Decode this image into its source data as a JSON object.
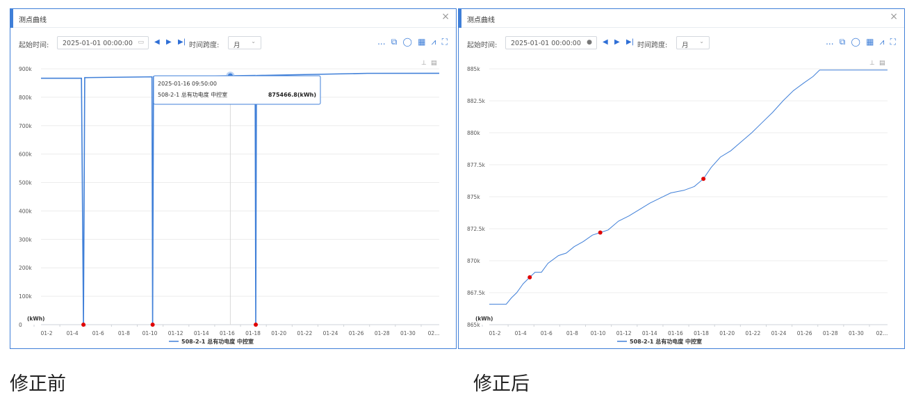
{
  "panels": [
    {
      "title": "测点曲线",
      "close": "×",
      "start_label": "起始时间:",
      "start_value": "2025-01-01 00:00:00",
      "span_label": "时间跨度:",
      "span_value": "月",
      "more": "...",
      "unit": "(kWh)",
      "legend": "508-2-1 总有功电度 中控室",
      "tooltip": {
        "time": "2025-01-16 09:50:00",
        "series": "508-2-1 总有功电度 中控室",
        "value": "875466.8(kWh)"
      }
    },
    {
      "title": "测点曲线",
      "close": "×",
      "start_label": "起始时间:",
      "start_value": "2025-01-01 00:00:00",
      "span_label": "时间跨度:",
      "span_value": "月",
      "more": "...",
      "unit": "(kWh)",
      "legend": "508-2-1 总有功电度 中控室"
    }
  ],
  "captions": {
    "before": "修正前",
    "after": "修正后"
  },
  "colors": {
    "line": "#3f7fd8",
    "marker": "#e00000",
    "frame": "#3f7fd8",
    "grid": "#ececec"
  },
  "icons": [
    "calendar-icon",
    "prev-icon",
    "next-icon",
    "last-icon",
    "export-icon",
    "refresh-icon",
    "table-icon",
    "line-chart-icon",
    "fullscreen-icon",
    "zoom-icon",
    "restore-icon"
  ],
  "chart_data": [
    {
      "type": "line",
      "title": "",
      "xlabel": "",
      "ylabel": "(kWh)",
      "ylim": [
        0,
        900000
      ],
      "y_ticks": [
        0,
        100000,
        200000,
        300000,
        400000,
        500000,
        600000,
        700000,
        800000,
        900000
      ],
      "y_tick_labels": [
        "0",
        "100k",
        "200k",
        "300k",
        "400k",
        "500k",
        "600k",
        "700k",
        "800k",
        "900k"
      ],
      "x_tick_labels": [
        "01-2",
        "01-4",
        "01-6",
        "01-8",
        "01-10",
        "01-12",
        "01-14",
        "01-16",
        "01-18",
        "01-20",
        "01-22",
        "01-24",
        "01-26",
        "01-28",
        "01-30",
        "02..."
      ],
      "x_range_days": [
        1.5,
        32
      ],
      "series": [
        {
          "name": "508-2-1 总有功电度 中控室",
          "points": [
            [
              1.5,
              866800
            ],
            [
              4.6,
              867000
            ],
            [
              4.75,
              0
            ],
            [
              4.85,
              869000
            ],
            [
              10.0,
              871800
            ],
            [
              10.05,
              0
            ],
            [
              10.12,
              872300
            ],
            [
              16.0,
              875300
            ],
            [
              17.9,
              876500
            ],
            [
              17.95,
              0
            ],
            [
              18.0,
              876600
            ],
            [
              26.5,
              884200
            ],
            [
              32,
              884300
            ]
          ]
        }
      ],
      "markers": [
        [
          4.75,
          0
        ],
        [
          10.05,
          0
        ],
        [
          17.95,
          0
        ]
      ],
      "highlight": [
        16.0,
        875466.8
      ],
      "legend_position": "bottom"
    },
    {
      "type": "line",
      "title": "",
      "xlabel": "",
      "ylabel": "(kWh)",
      "ylim": [
        865000,
        885000
      ],
      "y_ticks": [
        865000,
        867500,
        870000,
        872500,
        875000,
        877500,
        880000,
        882500,
        885000
      ],
      "y_tick_labels": [
        "865k",
        "867.5k",
        "870k",
        "872.5k",
        "875k",
        "877.5k",
        "880k",
        "882.5k",
        "885k"
      ],
      "x_tick_labels": [
        "01-2",
        "01-4",
        "01-6",
        "01-8",
        "01-10",
        "01-12",
        "01-14",
        "01-16",
        "01-18",
        "01-20",
        "01-22",
        "01-24",
        "01-26",
        "01-28",
        "01-30",
        "02..."
      ],
      "x_range_days": [
        1.5,
        32
      ],
      "series": [
        {
          "name": "508-2-1 总有功电度 中控室",
          "points": [
            [
              1.5,
              866600
            ],
            [
              2.8,
              866600
            ],
            [
              3.2,
              867100
            ],
            [
              3.6,
              867500
            ],
            [
              4.1,
              868200
            ],
            [
              4.6,
              868700
            ],
            [
              5.0,
              869100
            ],
            [
              5.5,
              869100
            ],
            [
              6.0,
              869800
            ],
            [
              6.8,
              870400
            ],
            [
              7.4,
              870600
            ],
            [
              8.0,
              871100
            ],
            [
              8.7,
              871500
            ],
            [
              9.4,
              872000
            ],
            [
              10.0,
              872200
            ],
            [
              10.6,
              872400
            ],
            [
              11.4,
              873100
            ],
            [
              12.2,
              873500
            ],
            [
              13.0,
              874000
            ],
            [
              13.8,
              874500
            ],
            [
              14.6,
              874900
            ],
            [
              15.4,
              875300
            ],
            [
              16.4,
              875500
            ],
            [
              17.2,
              875800
            ],
            [
              17.9,
              876400
            ],
            [
              18.5,
              877300
            ],
            [
              19.2,
              878100
            ],
            [
              20.0,
              878600
            ],
            [
              20.8,
              879300
            ],
            [
              21.6,
              880000
            ],
            [
              22.4,
              880800
            ],
            [
              23.2,
              881600
            ],
            [
              24.0,
              882500
            ],
            [
              24.8,
              883300
            ],
            [
              25.6,
              883900
            ],
            [
              26.3,
              884400
            ],
            [
              26.8,
              884900
            ],
            [
              32,
              884900
            ]
          ]
        }
      ],
      "markers": [
        [
          4.6,
          868700
        ],
        [
          10.0,
          872200
        ],
        [
          17.9,
          876400
        ]
      ],
      "legend_position": "bottom"
    }
  ]
}
